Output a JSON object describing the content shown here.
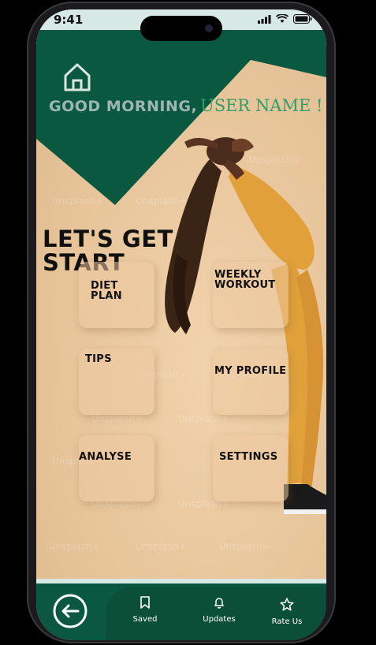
{
  "status_bar": {
    "time": "9:41"
  },
  "header": {
    "greeting": "GOOD MORNING,",
    "user_name": "USER NAME !"
  },
  "main": {
    "heading": "LET'S GET START",
    "cards": [
      {
        "label": "DIET PLAN"
      },
      {
        "label": "WEEKLY WORKOUT"
      },
      {
        "label": "TIPS"
      },
      {
        "label": "MY PROFILE"
      },
      {
        "label": "ANALYSE"
      },
      {
        "label": "SETTINGS"
      }
    ],
    "watermark": "Unsplash+"
  },
  "bottom_nav": {
    "items": [
      {
        "label": "Saved",
        "icon": "bookmark-icon"
      },
      {
        "label": "Updates",
        "icon": "bell-icon"
      },
      {
        "label": "Rate Us",
        "icon": "star-icon"
      }
    ]
  },
  "colors": {
    "primary_green": "#0a5840",
    "accent_text": "#2f9e6b",
    "background": "#e8c9a3"
  }
}
